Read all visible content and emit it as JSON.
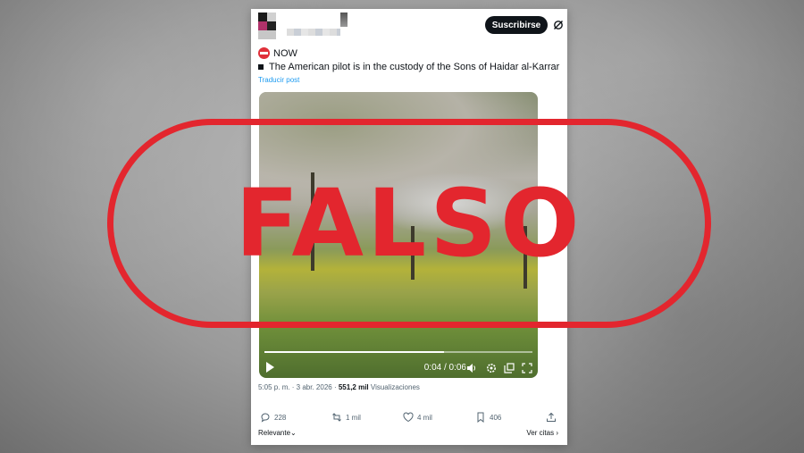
{
  "header": {
    "subscribe_label": "Suscribirse"
  },
  "tweet": {
    "now_label": "NOW",
    "text": "The American pilot is in the custody of the Sons of Haidar al-Karrar",
    "translate_label": "Traducir post"
  },
  "video": {
    "time": "0:04 / 0:06",
    "progress": 0.67
  },
  "meta": {
    "time": "5:05 p. m. · 3 abr. 2026 ·",
    "views_count": "551,2 mil",
    "views_label": "Visualizaciones"
  },
  "actions": {
    "replies": "228",
    "reposts": "1 mil",
    "likes": "4 mil",
    "bookmarks": "406"
  },
  "footer": {
    "relevance_label": "Relevante",
    "quotes_label": "Ver citas"
  },
  "stamp": {
    "text": "FALSO",
    "color": "#e3262e"
  },
  "colors": {
    "link": "#1d9bf0",
    "text": "#0f1419",
    "muted": "#536471"
  }
}
